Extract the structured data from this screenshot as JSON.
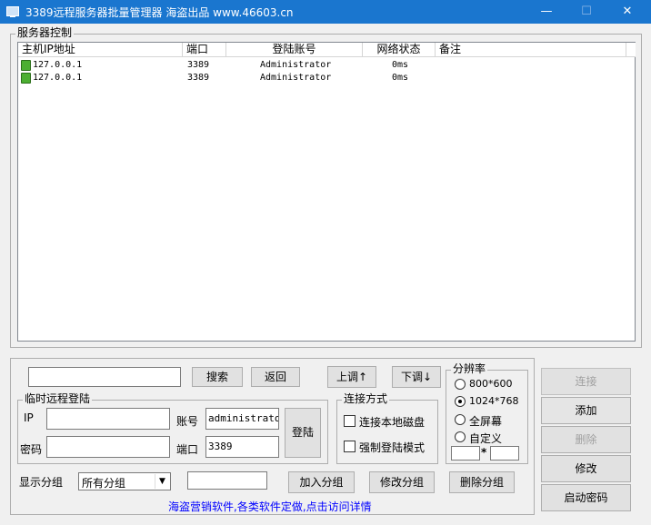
{
  "window": {
    "title": "3389远程服务器批量管理器 海盗出品 www.46603.cn",
    "minimize": "—",
    "maximize": "☐",
    "close": "✕"
  },
  "server_group": {
    "label": "服务器控制",
    "columns": [
      "主机IP地址",
      "端口",
      "登陆账号",
      "网络状态",
      "备注"
    ],
    "rows": [
      {
        "ip": "127.0.0.1",
        "port": "3389",
        "account": "Administrator",
        "status": "0ms",
        "note": ""
      },
      {
        "ip": "127.0.0.1",
        "port": "3389",
        "account": "Administrator",
        "status": "0ms",
        "note": ""
      }
    ]
  },
  "search": {
    "value": "",
    "search_label": "搜索",
    "back_label": "返回"
  },
  "move": {
    "up_label": "上调↑",
    "down_label": "下调↓"
  },
  "temp_login": {
    "label": "临时远程登陆",
    "ip_label": "IP",
    "ip_value": "",
    "password_label": "密码",
    "password_value": "",
    "account_label": "账号",
    "account_value": "administrator",
    "port_label": "端口",
    "port_value": "3389",
    "login_label": "登陆"
  },
  "connect_mode": {
    "label": "连接方式",
    "local_disk_label": "连接本地磁盘",
    "force_login_label": "强制登陆模式"
  },
  "resolution": {
    "label": "分辨率",
    "options": [
      "800*600",
      "1024*768",
      "全屏幕",
      "自定义"
    ],
    "selected": "1024*768",
    "custom_sep": "*",
    "custom_w": "",
    "custom_h": ""
  },
  "group": {
    "label": "显示分组",
    "selected": "所有分组",
    "name_value": "",
    "add_label": "加入分组",
    "edit_label": "修改分组",
    "delete_label": "删除分组"
  },
  "side_buttons": {
    "connect": "连接",
    "add": "添加",
    "delete": "删除",
    "edit": "修改",
    "start_password": "启动密码"
  },
  "footer_link": "海盗营销软件,各类软件定做,点击访问详情"
}
